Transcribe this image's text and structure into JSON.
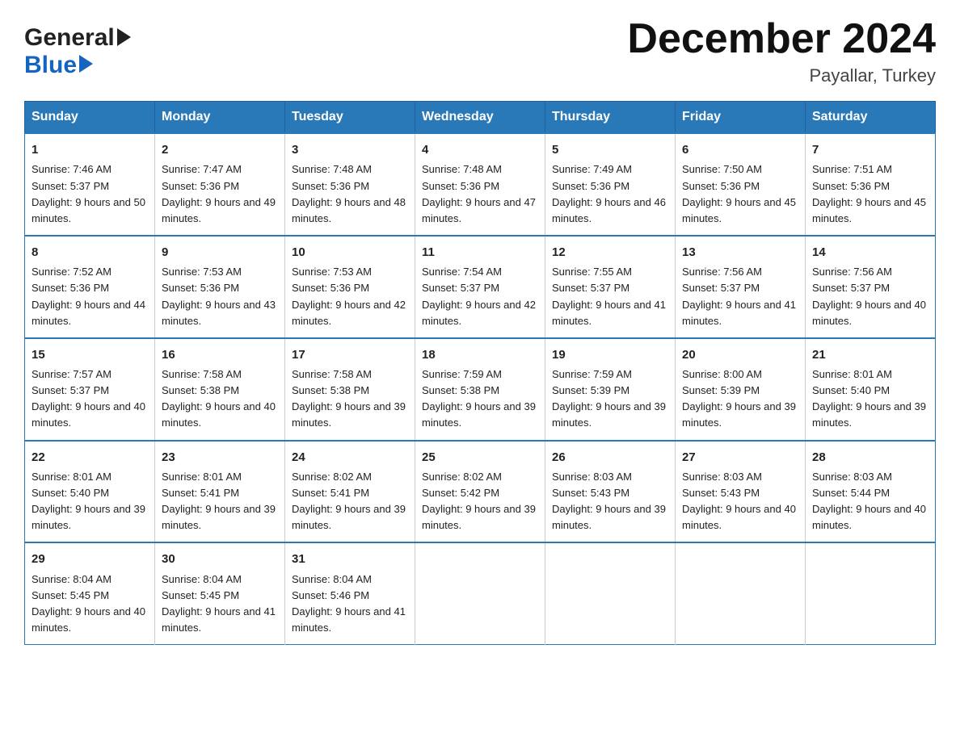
{
  "logo": {
    "line1": "General",
    "line2": "Blue"
  },
  "header": {
    "title": "December 2024",
    "subtitle": "Payallar, Turkey"
  },
  "weekdays": [
    "Sunday",
    "Monday",
    "Tuesday",
    "Wednesday",
    "Thursday",
    "Friday",
    "Saturday"
  ],
  "weeks": [
    [
      {
        "day": "1",
        "sunrise": "Sunrise: 7:46 AM",
        "sunset": "Sunset: 5:37 PM",
        "daylight": "Daylight: 9 hours and 50 minutes."
      },
      {
        "day": "2",
        "sunrise": "Sunrise: 7:47 AM",
        "sunset": "Sunset: 5:36 PM",
        "daylight": "Daylight: 9 hours and 49 minutes."
      },
      {
        "day": "3",
        "sunrise": "Sunrise: 7:48 AM",
        "sunset": "Sunset: 5:36 PM",
        "daylight": "Daylight: 9 hours and 48 minutes."
      },
      {
        "day": "4",
        "sunrise": "Sunrise: 7:48 AM",
        "sunset": "Sunset: 5:36 PM",
        "daylight": "Daylight: 9 hours and 47 minutes."
      },
      {
        "day": "5",
        "sunrise": "Sunrise: 7:49 AM",
        "sunset": "Sunset: 5:36 PM",
        "daylight": "Daylight: 9 hours and 46 minutes."
      },
      {
        "day": "6",
        "sunrise": "Sunrise: 7:50 AM",
        "sunset": "Sunset: 5:36 PM",
        "daylight": "Daylight: 9 hours and 45 minutes."
      },
      {
        "day": "7",
        "sunrise": "Sunrise: 7:51 AM",
        "sunset": "Sunset: 5:36 PM",
        "daylight": "Daylight: 9 hours and 45 minutes."
      }
    ],
    [
      {
        "day": "8",
        "sunrise": "Sunrise: 7:52 AM",
        "sunset": "Sunset: 5:36 PM",
        "daylight": "Daylight: 9 hours and 44 minutes."
      },
      {
        "day": "9",
        "sunrise": "Sunrise: 7:53 AM",
        "sunset": "Sunset: 5:36 PM",
        "daylight": "Daylight: 9 hours and 43 minutes."
      },
      {
        "day": "10",
        "sunrise": "Sunrise: 7:53 AM",
        "sunset": "Sunset: 5:36 PM",
        "daylight": "Daylight: 9 hours and 42 minutes."
      },
      {
        "day": "11",
        "sunrise": "Sunrise: 7:54 AM",
        "sunset": "Sunset: 5:37 PM",
        "daylight": "Daylight: 9 hours and 42 minutes."
      },
      {
        "day": "12",
        "sunrise": "Sunrise: 7:55 AM",
        "sunset": "Sunset: 5:37 PM",
        "daylight": "Daylight: 9 hours and 41 minutes."
      },
      {
        "day": "13",
        "sunrise": "Sunrise: 7:56 AM",
        "sunset": "Sunset: 5:37 PM",
        "daylight": "Daylight: 9 hours and 41 minutes."
      },
      {
        "day": "14",
        "sunrise": "Sunrise: 7:56 AM",
        "sunset": "Sunset: 5:37 PM",
        "daylight": "Daylight: 9 hours and 40 minutes."
      }
    ],
    [
      {
        "day": "15",
        "sunrise": "Sunrise: 7:57 AM",
        "sunset": "Sunset: 5:37 PM",
        "daylight": "Daylight: 9 hours and 40 minutes."
      },
      {
        "day": "16",
        "sunrise": "Sunrise: 7:58 AM",
        "sunset": "Sunset: 5:38 PM",
        "daylight": "Daylight: 9 hours and 40 minutes."
      },
      {
        "day": "17",
        "sunrise": "Sunrise: 7:58 AM",
        "sunset": "Sunset: 5:38 PM",
        "daylight": "Daylight: 9 hours and 39 minutes."
      },
      {
        "day": "18",
        "sunrise": "Sunrise: 7:59 AM",
        "sunset": "Sunset: 5:38 PM",
        "daylight": "Daylight: 9 hours and 39 minutes."
      },
      {
        "day": "19",
        "sunrise": "Sunrise: 7:59 AM",
        "sunset": "Sunset: 5:39 PM",
        "daylight": "Daylight: 9 hours and 39 minutes."
      },
      {
        "day": "20",
        "sunrise": "Sunrise: 8:00 AM",
        "sunset": "Sunset: 5:39 PM",
        "daylight": "Daylight: 9 hours and 39 minutes."
      },
      {
        "day": "21",
        "sunrise": "Sunrise: 8:01 AM",
        "sunset": "Sunset: 5:40 PM",
        "daylight": "Daylight: 9 hours and 39 minutes."
      }
    ],
    [
      {
        "day": "22",
        "sunrise": "Sunrise: 8:01 AM",
        "sunset": "Sunset: 5:40 PM",
        "daylight": "Daylight: 9 hours and 39 minutes."
      },
      {
        "day": "23",
        "sunrise": "Sunrise: 8:01 AM",
        "sunset": "Sunset: 5:41 PM",
        "daylight": "Daylight: 9 hours and 39 minutes."
      },
      {
        "day": "24",
        "sunrise": "Sunrise: 8:02 AM",
        "sunset": "Sunset: 5:41 PM",
        "daylight": "Daylight: 9 hours and 39 minutes."
      },
      {
        "day": "25",
        "sunrise": "Sunrise: 8:02 AM",
        "sunset": "Sunset: 5:42 PM",
        "daylight": "Daylight: 9 hours and 39 minutes."
      },
      {
        "day": "26",
        "sunrise": "Sunrise: 8:03 AM",
        "sunset": "Sunset: 5:43 PM",
        "daylight": "Daylight: 9 hours and 39 minutes."
      },
      {
        "day": "27",
        "sunrise": "Sunrise: 8:03 AM",
        "sunset": "Sunset: 5:43 PM",
        "daylight": "Daylight: 9 hours and 40 minutes."
      },
      {
        "day": "28",
        "sunrise": "Sunrise: 8:03 AM",
        "sunset": "Sunset: 5:44 PM",
        "daylight": "Daylight: 9 hours and 40 minutes."
      }
    ],
    [
      {
        "day": "29",
        "sunrise": "Sunrise: 8:04 AM",
        "sunset": "Sunset: 5:45 PM",
        "daylight": "Daylight: 9 hours and 40 minutes."
      },
      {
        "day": "30",
        "sunrise": "Sunrise: 8:04 AM",
        "sunset": "Sunset: 5:45 PM",
        "daylight": "Daylight: 9 hours and 41 minutes."
      },
      {
        "day": "31",
        "sunrise": "Sunrise: 8:04 AM",
        "sunset": "Sunset: 5:46 PM",
        "daylight": "Daylight: 9 hours and 41 minutes."
      },
      null,
      null,
      null,
      null
    ]
  ]
}
